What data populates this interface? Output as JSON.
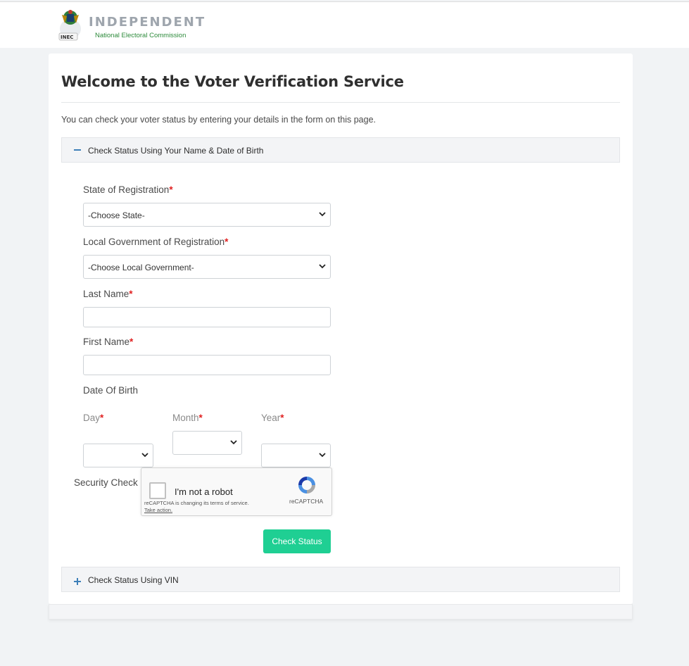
{
  "header": {
    "logo_badge": "INEC",
    "brand_title": "INDEPENDENT",
    "brand_subtitle": "National Electoral Commission"
  },
  "page": {
    "title": "Welcome to the Voter Verification Service",
    "intro": "You can check your voter status by entering your details in the form on this page."
  },
  "accordion": {
    "name_dob": {
      "icon": "minus-icon",
      "label": "Check Status Using Your Name & Date of Birth",
      "expanded": true
    },
    "vin": {
      "icon": "plus-icon",
      "label": "Check Status Using VIN",
      "expanded": false
    }
  },
  "form": {
    "required_marker": "*",
    "state": {
      "label": "State of Registration",
      "value": "-Choose State-"
    },
    "lga": {
      "label": "Local Government of Registration",
      "value": "-Choose Local Government-"
    },
    "last_name": {
      "label": "Last Name",
      "value": ""
    },
    "first_name": {
      "label": "First Name",
      "value": ""
    },
    "dob": {
      "label": "Date Of Birth",
      "day_label": "Day",
      "month_label": "Month",
      "year_label": "Year"
    },
    "security_label": "Security Check",
    "submit_label": "Check Status"
  },
  "captcha": {
    "checkbox_label": "I'm not a robot",
    "notice": "reCAPTCHA is changing its terms of service.",
    "notice_link": "Take action.",
    "brand": "reCAPTCHA"
  },
  "colors": {
    "accent": "#1fcf93",
    "required": "#e02020",
    "accordion_icon": "#3d7fb8",
    "brand_green": "#2c8a3a"
  }
}
